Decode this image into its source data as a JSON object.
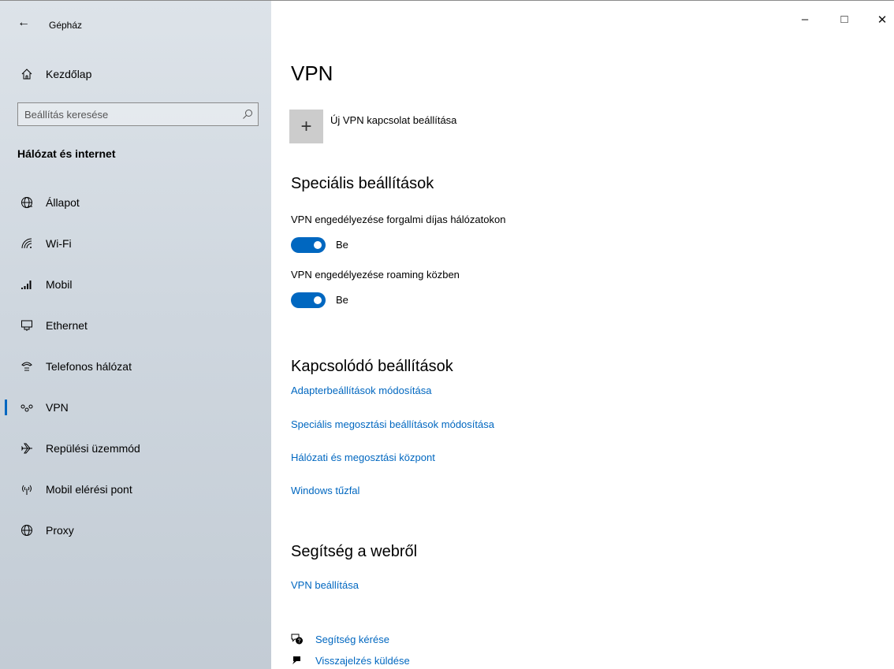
{
  "window": {
    "title": "Gépház",
    "back_glyph": "←",
    "controls": {
      "minimize": "–",
      "maximize": "□",
      "close": "✕"
    }
  },
  "sidebar": {
    "home": {
      "label": "Kezdőlap",
      "icon": "home-icon"
    },
    "search": {
      "placeholder": "Beállítás keresése",
      "icon": "search-icon"
    },
    "section_title": "Hálózat és internet",
    "items": [
      {
        "label": "Állapot",
        "icon": "globe-status-icon"
      },
      {
        "label": "Wi-Fi",
        "icon": "wifi-icon"
      },
      {
        "label": "Mobil",
        "icon": "signal-bars-icon"
      },
      {
        "label": "Ethernet",
        "icon": "ethernet-icon"
      },
      {
        "label": "Telefonos hálózat",
        "icon": "dialup-icon"
      },
      {
        "label": "VPN",
        "icon": "vpn-icon",
        "active": true
      },
      {
        "label": "Repülési üzemmód",
        "icon": "airplane-icon"
      },
      {
        "label": "Mobil elérési pont",
        "icon": "hotspot-icon"
      },
      {
        "label": "Proxy",
        "icon": "globe-icon"
      }
    ]
  },
  "main": {
    "title": "VPN",
    "add_vpn": {
      "label": "Új VPN kapcsolat beállítása",
      "glyph": "+"
    },
    "advanced": {
      "heading": "Speciális beállítások",
      "settings": [
        {
          "label": "VPN engedélyezése forgalmi díjas hálózatokon",
          "state": "Be",
          "on": true
        },
        {
          "label": "VPN engedélyezése roaming közben",
          "state": "Be",
          "on": true
        }
      ]
    },
    "related": {
      "heading": "Kapcsolódó beállítások",
      "links": [
        "Adapterbeállítások módosítása",
        "Speciális megosztási beállítások módosítása",
        "Hálózati és megosztási központ",
        "Windows tűzfal"
      ]
    },
    "web_help": {
      "heading": "Segítség a webről",
      "links": [
        "VPN beállítása"
      ]
    },
    "help_links": [
      {
        "label": "Segítség kérése",
        "icon": "help-chat-icon"
      },
      {
        "label": "Visszajelzés küldése",
        "icon": "feedback-icon"
      }
    ]
  },
  "colors": {
    "accent": "#0067c0",
    "sidebar_bg": "#cfd7df",
    "tile_bg": "#cccccc"
  }
}
